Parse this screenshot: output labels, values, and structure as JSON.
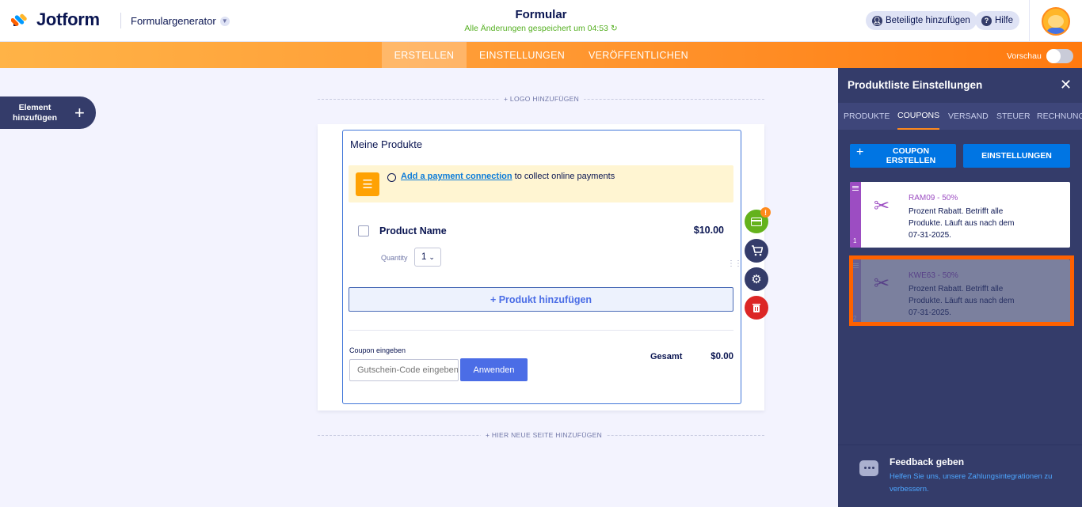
{
  "header": {
    "logo_text": "Jotform",
    "builder_label": "Formulargenerator",
    "form_title": "Formular",
    "save_status": "Alle Änderungen gespeichert um 04:53",
    "add_participants_label": "Beteiligte hinzufügen",
    "help_label": "Hilfe"
  },
  "nav": {
    "tabs": [
      {
        "label": "ERSTELLEN",
        "active": true
      },
      {
        "label": "EINSTELLUNGEN",
        "active": false
      },
      {
        "label": "VERÖFFENTLICHEN",
        "active": false
      }
    ],
    "preview_label": "Vorschau",
    "preview_on": false
  },
  "canvas": {
    "add_element_label": "Element hinzufügen",
    "add_logo_label": "+ LOGO HINZUFÜGEN",
    "add_page_label": "+ HIER NEUE SEITE HINZUFÜGEN"
  },
  "product_list": {
    "title": "Meine Produkte",
    "payment_link": "Add a payment connection",
    "payment_text": " to collect online payments",
    "product_name": "Product Name",
    "product_price": "$10.00",
    "quantity_label": "Quantity",
    "quantity_value": "1",
    "add_product_label": "+ Produkt hinzufügen",
    "coupon_label": "Coupon eingeben",
    "coupon_placeholder": "Gutschein-Code eingeben",
    "apply_label": "Anwenden",
    "total_label": "Gesamt",
    "total_value": "$0.00",
    "warning_badge": "!"
  },
  "panel": {
    "title": "Produktliste Einstellungen",
    "tabs": [
      {
        "label": "PRODUKTE",
        "active": false
      },
      {
        "label": "COUPONS",
        "active": true
      },
      {
        "label": "VERSAND",
        "active": false
      },
      {
        "label": "STEUER",
        "active": false
      },
      {
        "label": "RECHNUNG",
        "active": false
      }
    ],
    "create_coupon_label": "COUPON ERSTELLEN",
    "settings_label": "EINSTELLUNGEN",
    "coupons": [
      {
        "index": "1",
        "code": "RAM09 - 50%",
        "description": "Prozent Rabatt. Betrifft alle Produkte. Läuft aus nach dem 07-31-2025.",
        "dimmed": false
      },
      {
        "index": "2",
        "code": "KWE63 - 50%",
        "description": "Prozent Rabatt. Betrifft alle Produkte. Läuft aus nach dem 07-31-2025.",
        "dimmed": true
      }
    ],
    "feedback_title": "Feedback geben",
    "feedback_text": "Helfen Sie uns, unsere Zahlungsintegrationen zu verbessern."
  },
  "colors": {
    "accent_orange": "#ff7a0f",
    "primary_blue": "#0075e3",
    "coupon_purple": "#9c4dc2",
    "selection_frame": "#ff6100",
    "success_green": "#56b023"
  }
}
